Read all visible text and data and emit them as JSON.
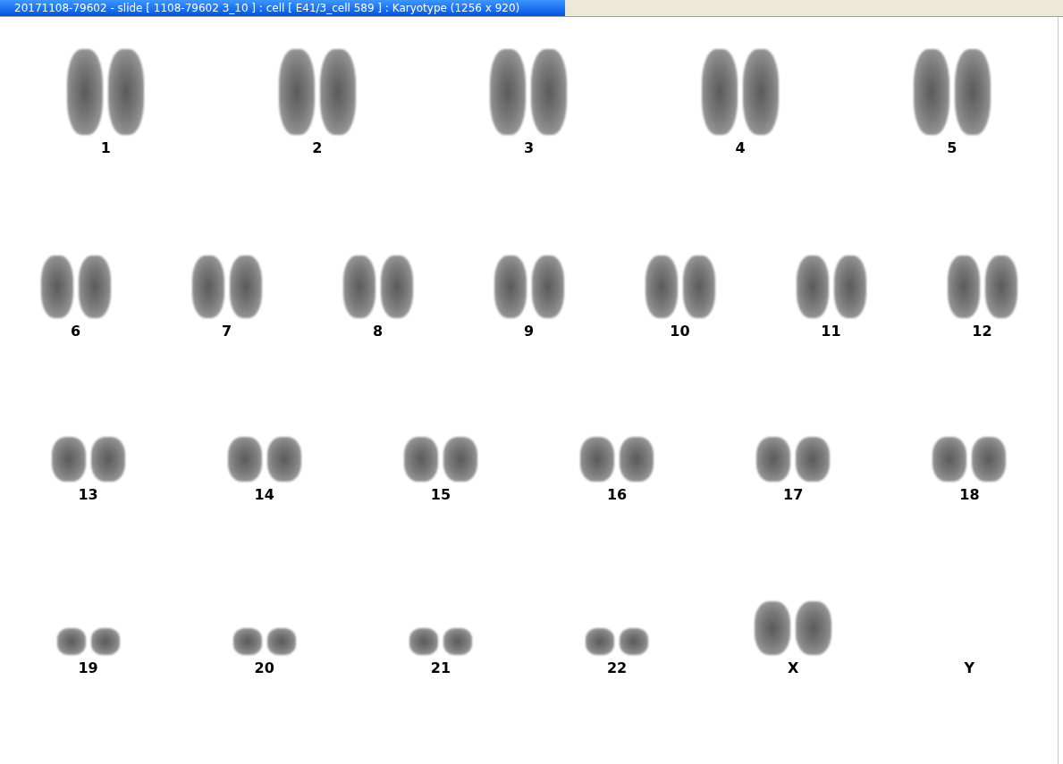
{
  "window": {
    "title": "20171108-79602 - slide [ 1108-79602 3_10 ] : cell [ E41/3_cell 589 ] : Karyotype  (1256 x 920)"
  },
  "karyotype_rows": [
    [
      {
        "label": "1",
        "kind": "pair"
      },
      {
        "label": "2",
        "kind": "pair"
      },
      {
        "label": "3",
        "kind": "pair"
      },
      {
        "label": "4",
        "kind": "pair"
      },
      {
        "label": "5",
        "kind": "pair"
      }
    ],
    [
      {
        "label": "6",
        "kind": "pair"
      },
      {
        "label": "7",
        "kind": "pair"
      },
      {
        "label": "8",
        "kind": "pair"
      },
      {
        "label": "9",
        "kind": "pair"
      },
      {
        "label": "10",
        "kind": "pair"
      },
      {
        "label": "11",
        "kind": "pair"
      },
      {
        "label": "12",
        "kind": "pair"
      }
    ],
    [
      {
        "label": "13",
        "kind": "pair"
      },
      {
        "label": "14",
        "kind": "pair"
      },
      {
        "label": "15",
        "kind": "pair"
      },
      {
        "label": "16",
        "kind": "pair"
      },
      {
        "label": "17",
        "kind": "pair"
      },
      {
        "label": "18",
        "kind": "pair"
      }
    ],
    [
      {
        "label": "19",
        "kind": "pair"
      },
      {
        "label": "20",
        "kind": "pair"
      },
      {
        "label": "21",
        "kind": "pair"
      },
      {
        "label": "22",
        "kind": "pair"
      },
      {
        "label": "X",
        "kind": "large-pair"
      },
      {
        "label": "Y",
        "kind": "empty"
      }
    ]
  ]
}
